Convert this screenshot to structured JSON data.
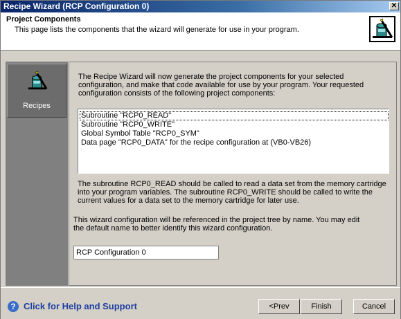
{
  "window": {
    "title": "Recipe Wizard (RCP Configuration 0)"
  },
  "header": {
    "title": "Project Components",
    "subtitle": "This page lists the components that the wizard will generate for use in your program."
  },
  "sidebar": {
    "items": [
      {
        "label": "Recipes",
        "icon": "recipe-wizard-icon"
      }
    ]
  },
  "main": {
    "intro": "The Recipe Wizard will now generate the project components for your selected configuration, and make that code available for use by your program. Your requested configuration consists of the following project components:",
    "components": [
      "Subroutine \"RCP0_READ\"",
      "Subroutine \"RCP0_WRITE\"",
      "Global Symbol Table \"RCP0_SYM\"",
      "Data page \"RCP0_DATA\" for the recipe configuration at (VB0-VB26)"
    ],
    "note": "The subroutine RCP0_READ should be called to read a data set from the memory cartridge into your program variables. The subroutine RCP0_WRITE should be called to write the current values for a data set to the memory cartridge for later use.",
    "name_note": "This wizard configuration will be referenced in the project tree by name. You may edit the default name to better identify this wizard configuration.",
    "config_name": "RCP Configuration 0"
  },
  "footer": {
    "help_label": "Click for Help and Support",
    "prev_label": "<Prev",
    "finish_label": "Finish",
    "cancel_label": "Cancel"
  }
}
